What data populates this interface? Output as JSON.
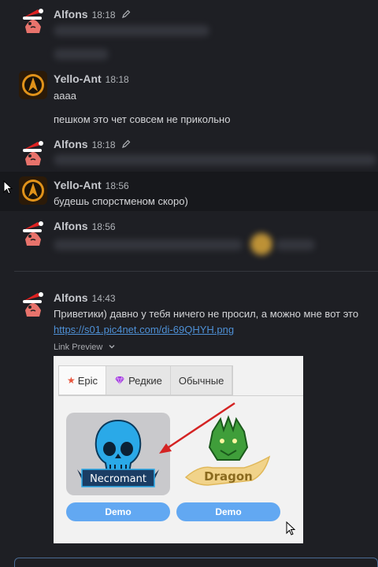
{
  "messages": [
    {
      "author": "Alfons",
      "time": "18:18",
      "edited": true
    },
    {
      "author": "Yello-Ant",
      "time": "18:18",
      "lines": [
        "аааа",
        "пешком это чет совсем не прикольно"
      ]
    },
    {
      "author": "Alfons",
      "time": "18:18",
      "edited": true
    },
    {
      "author": "Yello-Ant",
      "time": "18:56",
      "lines": [
        "будешь спорстменом скоро)"
      ]
    },
    {
      "author": "Alfons",
      "time": "18:56"
    },
    {
      "author": "Alfons",
      "time": "14:43",
      "text": "Приветики) давно у тебя ничего не просил, а можно мне вот это",
      "link": "https://s01.pic4net.com/di-69QHYH.png"
    }
  ],
  "link_preview": {
    "label": "Link Preview",
    "tabs": [
      "Epic",
      "Редкие",
      "Обычные"
    ],
    "cards": [
      "Necromant",
      "Dragon"
    ],
    "button": "Demo"
  },
  "colors": {
    "background": "#1e1f24",
    "link": "#4e90d6",
    "demo_button": "#62a8f2",
    "epic_star": "#e8553d",
    "gem": "#a43ee0"
  }
}
